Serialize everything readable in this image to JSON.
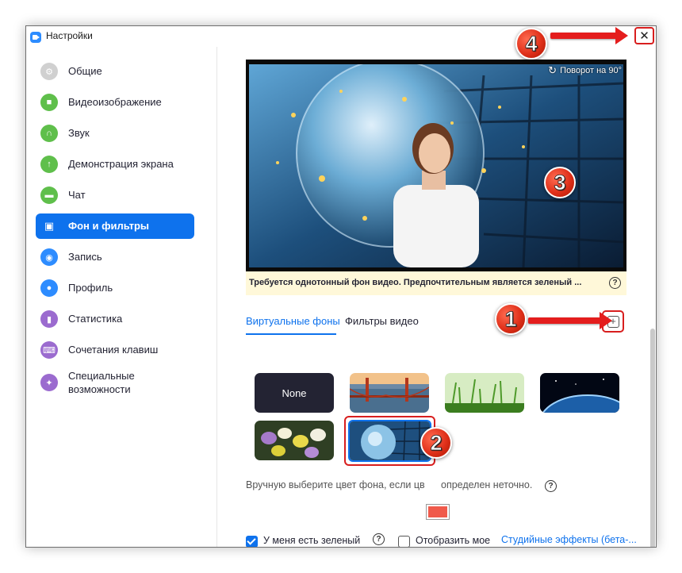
{
  "window": {
    "title": "Настройки",
    "close_label": "✕"
  },
  "sidebar": {
    "items": [
      {
        "label": "Общие",
        "icon": "gear-icon",
        "color": "#c8c8c8"
      },
      {
        "label": "Видеоизображение",
        "icon": "video-camera-icon",
        "color": "#5fbf4b"
      },
      {
        "label": "Звук",
        "icon": "headphones-icon",
        "color": "#5fbf4b"
      },
      {
        "label": "Демонстрация экрана",
        "icon": "share-screen-icon",
        "color": "#5fbf4b"
      },
      {
        "label": "Чат",
        "icon": "chat-bubble-icon",
        "color": "#5fbf4b"
      },
      {
        "label": "Фон и фильтры",
        "icon": "background-portrait-icon",
        "color": "#0e72ed"
      },
      {
        "label": "Запись",
        "icon": "record-icon",
        "color": "#2d8cff"
      },
      {
        "label": "Профиль",
        "icon": "profile-icon",
        "color": "#2d8cff"
      },
      {
        "label": "Статистика",
        "icon": "statistics-icon",
        "color": "#9b6bcf"
      },
      {
        "label": "Сочетания клавиш",
        "icon": "keyboard-icon",
        "color": "#9b6bcf"
      },
      {
        "label": "Специальные возможности",
        "icon": "accessibility-icon",
        "color": "#9b6bcf"
      }
    ],
    "active_index": 5
  },
  "preview": {
    "rotate_label": "Поворот на 90°"
  },
  "warning": {
    "text": "Требуется однотонный фон видео. Предпочтительным является зеленый ...",
    "help": "?"
  },
  "tabs": {
    "virtual_backgrounds": "Виртуальные фоны",
    "video_filters": "Фильтры видео",
    "active": "virtual_backgrounds"
  },
  "add_button": "+",
  "backgrounds": [
    {
      "label": "None",
      "kind": "none"
    },
    {
      "kind": "golden-gate-bridge"
    },
    {
      "kind": "grass"
    },
    {
      "kind": "earth-from-space"
    },
    {
      "kind": "crocus-flowers"
    },
    {
      "kind": "crystal-globe-keyboard",
      "selected": true
    }
  ],
  "manual_color": {
    "text_left": "Вручную выберите цвет фона, если цв",
    "text_right": "определен неточно.",
    "help": "?",
    "swatch_color": "#f05a4b"
  },
  "options": {
    "green_screen_label": "У меня есть зеленый экран",
    "green_screen_checked": true,
    "mirror_label": "Отобразить мое видео зеркально",
    "mirror_checked": false,
    "studio_link": "Студийные эффекты (бета-..."
  },
  "annotations": [
    "1",
    "2",
    "3",
    "4"
  ]
}
